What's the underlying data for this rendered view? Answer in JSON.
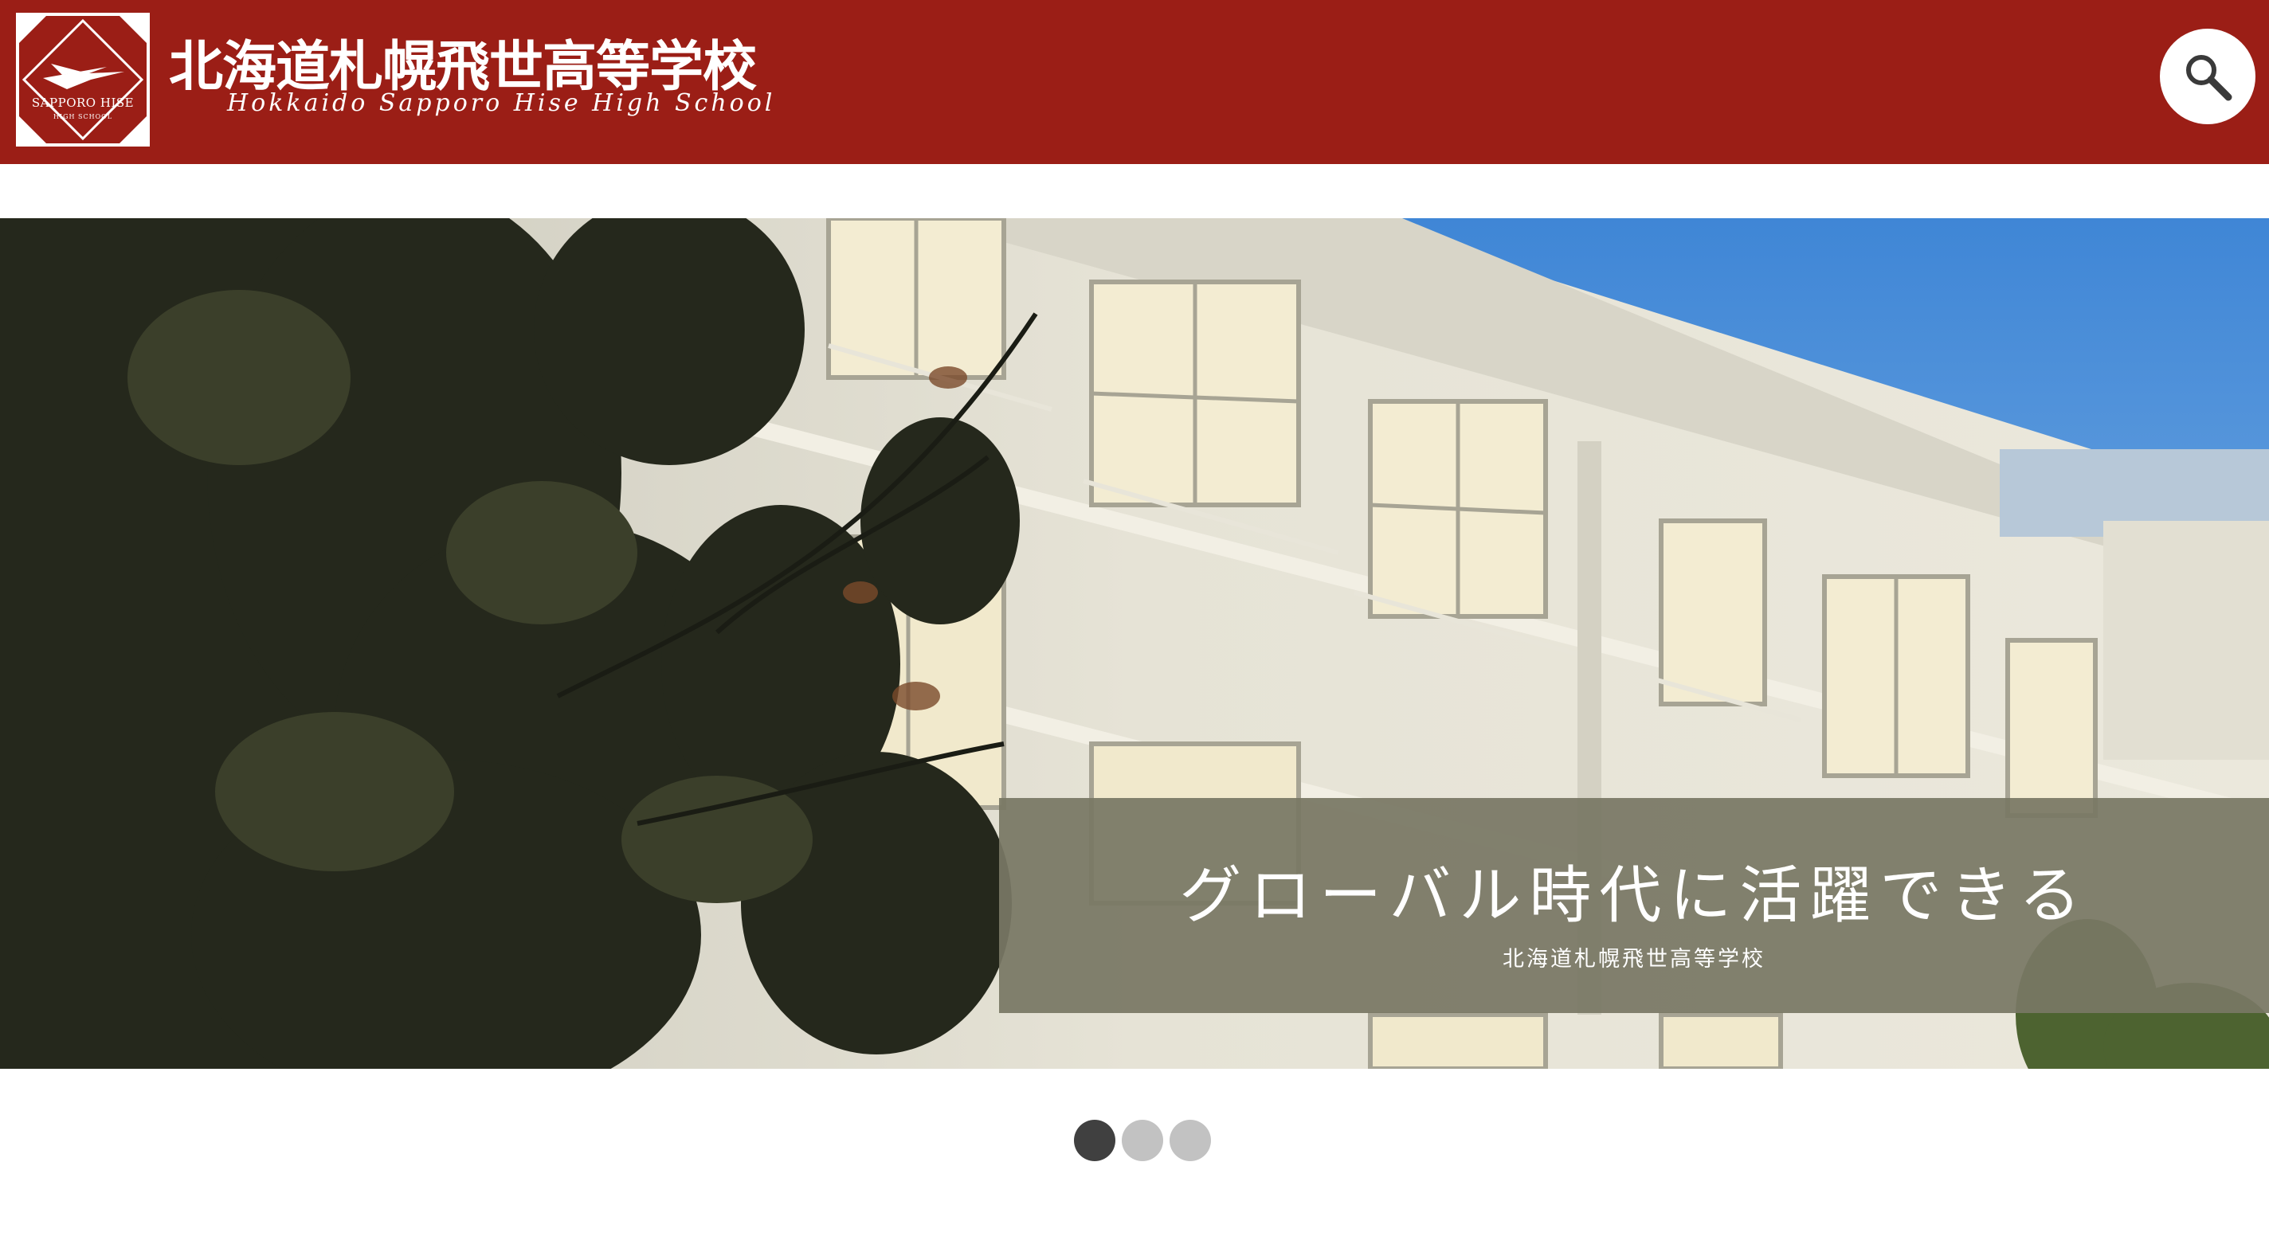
{
  "header": {
    "logo": {
      "line1": "SAPPORO HISE",
      "line2": "HIGH SCHOOL",
      "icon": "bird-emblem-icon"
    },
    "title": "北海道札幌飛世高等学校",
    "subtitle": "Hokkaido Sapporo Hise High School",
    "search_icon": "search-icon",
    "color": "#9b1e16"
  },
  "hero": {
    "caption_main": "グローバル時代に活躍できる",
    "caption_sub": "北海道札幌飛世高等学校",
    "caption_bg": "#797764"
  },
  "carousel": {
    "slide_count": 3,
    "active_index": 0
  }
}
